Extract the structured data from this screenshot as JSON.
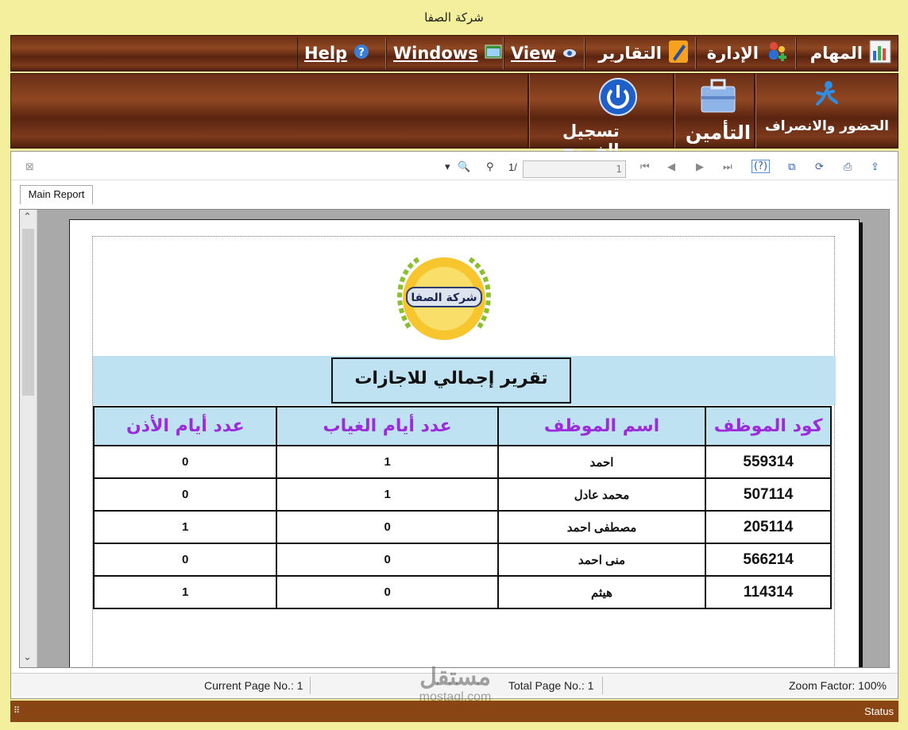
{
  "window": {
    "title": "شركة الصفا"
  },
  "menubar": {
    "tasks": "المهام",
    "admin": "الإدارة",
    "reports": "التقارير",
    "view_label": "View",
    "windows_label": "Windows",
    "help_label": "Help"
  },
  "toolbar": {
    "attendance": "الحضور والانصراف",
    "insurance": "التأمين",
    "logout": "تسجيل الخروج"
  },
  "viewer": {
    "page_of": "1/",
    "page_value": "1",
    "tab": "Main Report",
    "current_page_label": "Current Page No.: 1",
    "total_page_label": "Total Page No.: 1",
    "zoom_label": "Zoom Factor: 100%"
  },
  "report": {
    "logo_text": "شركة الصفا",
    "title": "تقرير إجمالي للاجازات",
    "columns": [
      "كود الموظف",
      "اسم الموظف",
      "عدد أيام الغياب",
      "عدد أيام الأذن"
    ],
    "rows": [
      {
        "code": "559314",
        "name": "احمد",
        "absence": "1",
        "permission": "0"
      },
      {
        "code": "507114",
        "name": "محمد عادل",
        "absence": "1",
        "permission": "0"
      },
      {
        "code": "205114",
        "name": "مصطفى احمد",
        "absence": "0",
        "permission": "1"
      },
      {
        "code": "566214",
        "name": "منى احمد",
        "absence": "0",
        "permission": "0"
      },
      {
        "code": "114314",
        "name": "هيثم",
        "absence": "0",
        "permission": "1"
      }
    ]
  },
  "statusbar": {
    "status": "Status"
  },
  "watermark": {
    "brand": "مستقل",
    "site": "mostaql.com"
  },
  "colors": {
    "wood": "#7d3a1c",
    "header_band": "#bfe2f3",
    "header_text": "#9c2bdc",
    "frame": "#f3ef9c"
  }
}
